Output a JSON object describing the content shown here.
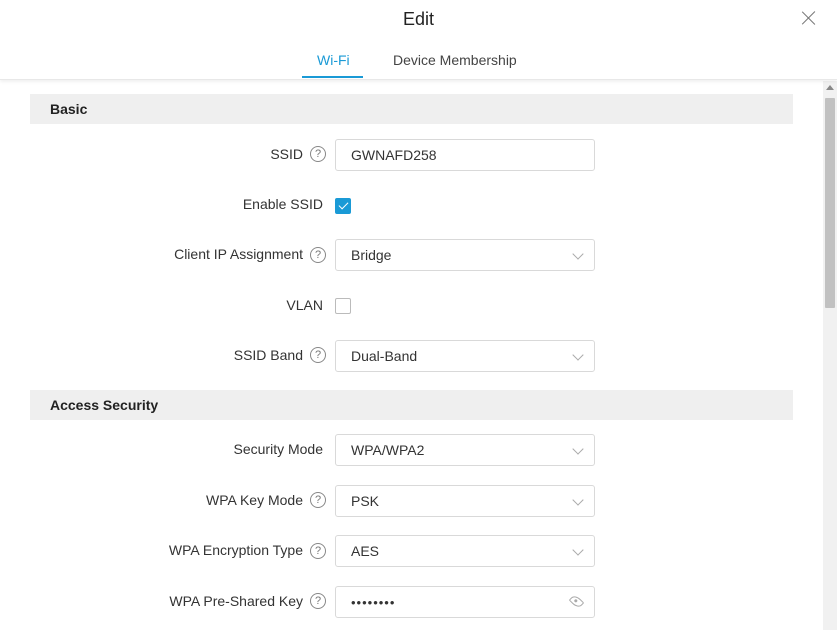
{
  "dialog": {
    "title": "Edit"
  },
  "tabs": [
    {
      "label": "Wi-Fi",
      "active": true
    },
    {
      "label": "Device Membership",
      "active": false
    }
  ],
  "sections": {
    "basic": "Basic",
    "access_security": "Access Security"
  },
  "fields": {
    "ssid": {
      "label": "SSID",
      "value": "GWNAFD258"
    },
    "enable_ssid": {
      "label": "Enable SSID",
      "checked": true
    },
    "client_ip": {
      "label": "Client IP Assignment",
      "value": "Bridge"
    },
    "vlan": {
      "label": "VLAN",
      "checked": false
    },
    "ssid_band": {
      "label": "SSID Band",
      "value": "Dual-Band"
    },
    "security_mode": {
      "label": "Security Mode",
      "value": "WPA/WPA2"
    },
    "wpa_key_mode": {
      "label": "WPA Key Mode",
      "value": "PSK"
    },
    "wpa_encryption": {
      "label": "WPA Encryption Type",
      "value": "AES"
    },
    "wpa_psk": {
      "label": "WPA Pre-Shared Key",
      "value": "••••••••"
    }
  },
  "help_glyph": "?",
  "colors": {
    "accent": "#1a9ad6",
    "section_bg": "#efefef"
  }
}
